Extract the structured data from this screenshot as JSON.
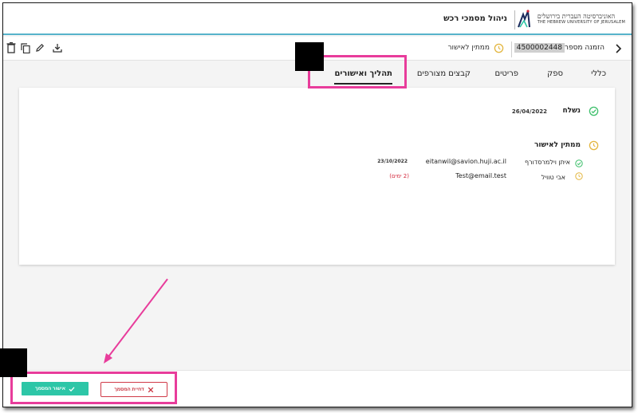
{
  "header": {
    "logo_hebrew": "האוניברסיטה העברית בירושלים",
    "logo_english": "THE HEBREW UNIVERSITY OF JERUSALEM",
    "app_title": "ניהול מסמכי רכש"
  },
  "toolbar": {
    "order_label": "הזמנה מספר:",
    "order_number": "4500002448",
    "status_text": "ממתין לאישור",
    "icons": [
      "delete-icon",
      "copy-icon",
      "edit-icon",
      "download-icon",
      "chevron-right-icon",
      "clock-icon"
    ]
  },
  "tabs": [
    {
      "label": "כללי",
      "active": false
    },
    {
      "label": "ספק",
      "active": false
    },
    {
      "label": "פריטים",
      "active": false
    },
    {
      "label": "קבצים מצורפים",
      "active": false
    },
    {
      "label": "תהליך ואישורים",
      "active": true
    }
  ],
  "process": {
    "sent": {
      "label": "נשלח",
      "date": "26/04/2022"
    },
    "pending": {
      "label": "ממתין לאישור"
    },
    "approvers": [
      {
        "name": "איתן וילמרסדורף",
        "email": "eitanwil@savion.huji.ac.il",
        "date": "23/10/2022",
        "status": "approved"
      },
      {
        "name": "אבי טוויל",
        "email": "Test@email.test",
        "days": "(2 ימים)",
        "status": "waiting"
      }
    ]
  },
  "footer": {
    "approve_label": "אישור המסמך",
    "reject_label": "דחיית המסמך"
  },
  "colors": {
    "accent_line": "#57b3ca",
    "highlight": "#e83c9b",
    "approve_green": "#2dc6a7",
    "reject_red": "#d03a48",
    "pending_clock": "#e3b63f",
    "approved_check": "#3cbf6a"
  }
}
